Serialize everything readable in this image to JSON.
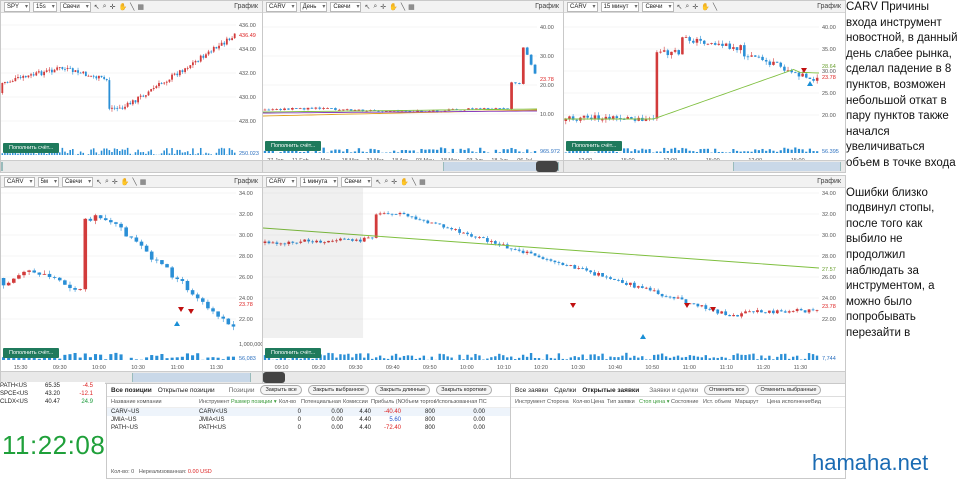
{
  "panels": [
    {
      "symbol": "SPY",
      "interval": "15s",
      "type": "Свечи",
      "title": "График",
      "yticks": [
        "436.00",
        "434.00",
        "432.00",
        "430.00",
        "428.00"
      ],
      "xticks": [
        "12:00",
        "10:00",
        "12:00",
        "12:00"
      ],
      "price_label": "436.49",
      "vol_label": "250.023",
      "fill_label": "Пополнить счёт..."
    },
    {
      "symbol": "CARV",
      "interval": "День",
      "type": "Свечи",
      "title": "График",
      "yticks": [
        "40.00",
        "30.00",
        "20.00",
        "10.00"
      ],
      "xticks": [
        "27 Jan",
        "11 Feb",
        "Mar",
        "18 Mar",
        "31 Mar",
        "18 Apr",
        "03 May",
        "18 May",
        "03 Jun",
        "18 Jun",
        "06 Jul"
      ],
      "price_label": "23.78",
      "vol_label": "965.972",
      "fill_label": "Пополнить счёт..."
    },
    {
      "symbol": "CARV",
      "interval": "15 минут",
      "type": "Свечи",
      "title": "График",
      "yticks": [
        "40.00",
        "35.00",
        "30.00",
        "25.00",
        "20.00"
      ],
      "xticks": [
        "12:00",
        "15:00",
        "12:00",
        "15:00",
        "12:00",
        "15:00"
      ],
      "price_label": "23.78",
      "ma_label": "28.64",
      "vol_label": "56.395",
      "fill_label": "Пополнить счёт..."
    },
    {
      "symbol": "CARV",
      "interval": "5м",
      "type": "Свечи",
      "title": "График",
      "yticks": [
        "34.00",
        "32.00",
        "30.00",
        "28.00",
        "26.00",
        "24.00",
        "22.00"
      ],
      "xticks": [
        "15:30",
        "09:30",
        "10:00",
        "10:30",
        "11:00",
        "11:30"
      ],
      "price_label": "23.78",
      "vol_top": "1,000,000",
      "vol_label": "56,083",
      "fill_label": "Пополнить счёт..."
    },
    {
      "symbol": "CARV",
      "interval": "1 минута",
      "type": "Свечи",
      "title": "График",
      "yticks": [
        "34.00",
        "32.00",
        "30.00",
        "28.00",
        "26.00",
        "24.00",
        "22.00"
      ],
      "xticks": [
        "09:10",
        "09:20",
        "09:30",
        "09:40",
        "09:50",
        "10:00",
        "10:10",
        "10:20",
        "10:30",
        "10:40",
        "10:50",
        "11:00",
        "11:10",
        "11:20",
        "11:30"
      ],
      "price_label": "23.78",
      "ma_label": "27.57",
      "vol_label": "7,744",
      "fill_label": "Пополнить счёт..."
    }
  ],
  "ticker_rows": [
    {
      "sym": "PATH<US",
      "price": "65.35",
      "chg": "-4.5"
    },
    {
      "sym": "SPCE<US",
      "price": "43.20",
      "chg": "-12.1"
    },
    {
      "sym": "CLDX<US",
      "price": "40.47",
      "chg": "24.9"
    }
  ],
  "clock": "11:22:08",
  "positions": {
    "section_title": "Позиции",
    "tabs": [
      "Все позиции",
      "Открытые позиции"
    ],
    "buttons": [
      "Закрыть все",
      "Закрыть выбранное",
      "Закрыть длинные",
      "Закрыть короткие"
    ],
    "columns": [
      "Название компании",
      "Инструмент",
      "Размер позиции ▾",
      "Кол-во",
      "Потенциальная",
      "Комиссии",
      "Прибыль (Net)",
      "Объем торгов",
      "Использованная ПС"
    ],
    "rows": [
      {
        "name": "CARV~US",
        "instr": "CARV<US",
        "size": "",
        "qty": "0",
        "pot": "0.00",
        "fee": "4.40",
        "pnl": "-40.40",
        "vol": "800",
        "used": "0.00"
      },
      {
        "name": "JMIA~US",
        "instr": "JMIA<US",
        "size": "",
        "qty": "0",
        "pot": "0.00",
        "fee": "4.40",
        "pnl": "5.60",
        "vol": "800",
        "used": "0.00"
      },
      {
        "name": "PATH~US",
        "instr": "PATH<US",
        "size": "",
        "qty": "0",
        "pot": "0.00",
        "fee": "4.40",
        "pnl": "-72.40",
        "vol": "800",
        "used": "0.00"
      }
    ],
    "footer_count": "Кол-во: 0",
    "footer_label": "Нереализованная:",
    "footer_value": "0.00 USD"
  },
  "orders": {
    "section_title": "Заявки и сделки",
    "tabs": [
      "Все заявки",
      "Сделки",
      "Открытые заявки"
    ],
    "buttons": [
      "Отменить все",
      "Отменить выбранные"
    ],
    "columns": [
      "Инструмент",
      "Сторона",
      "Кол-во",
      "Цена",
      "Тип заявки",
      "Стоп цена ▾",
      "Состояние",
      "Ист. объем",
      "Маршрут",
      "Цена исполнения",
      "Вид"
    ]
  },
  "notes": {
    "p1": "CARV Причины входа инструмент новостной, в данный день слабее рынка, сделал падение в 8 пунктов, возможен небольшой откат в пару пунктов также начался увеличиваться объем в точке входа",
    "p2": "Ошибки близко подвинул стопы, после того как выбило не продолжил наблюдать за инструментом, а можно было попробывать перезайти в"
  },
  "watermark": "hamaha.net",
  "colors": {
    "up": "#2a8fd6",
    "down": "#d23b3b",
    "ma": "#7fbf3f",
    "ma2": "#e0a020",
    "volume": "#2a8fd6",
    "clock": "#1fa03a",
    "fill_button": "#1f7a5c"
  }
}
